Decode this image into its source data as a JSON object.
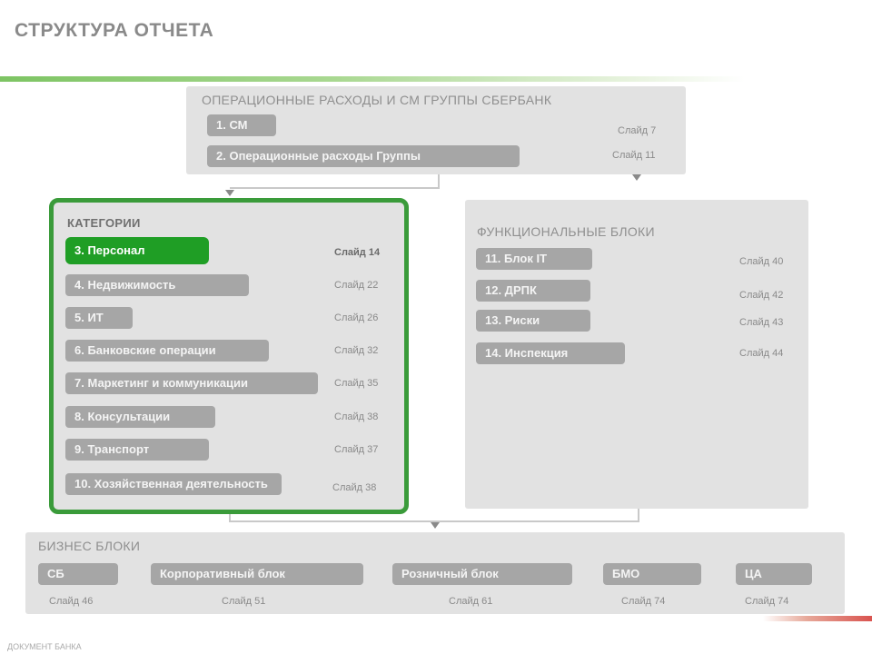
{
  "page": {
    "title": "СТРУКТУРА ОТЧЕТА",
    "footer": "ДОКУМЕНТ БАНКА"
  },
  "top_panel": {
    "label": "ОПЕРАЦИОННЫЕ РАСХОДЫ И СМ ГРУППЫ СБЕРБАНК",
    "items": [
      {
        "label": "1. СМ",
        "ref": "Слайд 7"
      },
      {
        "label": "2. Операционные расходы Группы",
        "ref": "Слайд 11"
      }
    ]
  },
  "categories_panel": {
    "label": "КАТЕГОРИИ",
    "items": [
      {
        "label": "3. Персонал",
        "ref": "Слайд 14",
        "active": true
      },
      {
        "label": "4. Недвижимость",
        "ref": "Слайд 22",
        "active": false
      },
      {
        "label": "5. ИТ",
        "ref": "Слайд 26",
        "active": false
      },
      {
        "label": "6. Банковские операции",
        "ref": "Слайд 32",
        "active": false
      },
      {
        "label": "7. Маркетинг и коммуникации",
        "ref": "Слайд 35",
        "active": false
      },
      {
        "label": "8. Консультации",
        "ref": "Слайд 38",
        "active": false
      },
      {
        "label": "9. Транспорт",
        "ref": "Слайд 37",
        "active": false
      },
      {
        "label": "10. Хозяйственная деятельность",
        "ref": "Слайд 38",
        "active": false
      }
    ]
  },
  "functional_panel": {
    "label": "ФУНКЦИОНАЛЬНЫЕ БЛОКИ",
    "items": [
      {
        "label": "11. Блок IT",
        "ref": "Слайд 40"
      },
      {
        "label": "12. ДРПК",
        "ref": "Слайд 42"
      },
      {
        "label": "13. Риски",
        "ref": "Слайд 43"
      },
      {
        "label": "14. Инспекция",
        "ref": "Слайд 44"
      }
    ]
  },
  "business_panel": {
    "label": "БИЗНЕС БЛОКИ",
    "items": [
      {
        "label": "СБ",
        "ref": "Слайд 46"
      },
      {
        "label": "Корпоративный блок",
        "ref": "Слайд 51"
      },
      {
        "label": "Розничный блок",
        "ref": "Слайд 61"
      },
      {
        "label": "БМО",
        "ref": "Слайд 74"
      },
      {
        "label": "ЦА",
        "ref": "Слайд 74"
      }
    ]
  },
  "colors": {
    "accent_green": "#1f9e25",
    "frame_green": "#3a9b3a",
    "pill_gray": "#a6a6a6",
    "panel_gray": "#e2e2e2"
  }
}
